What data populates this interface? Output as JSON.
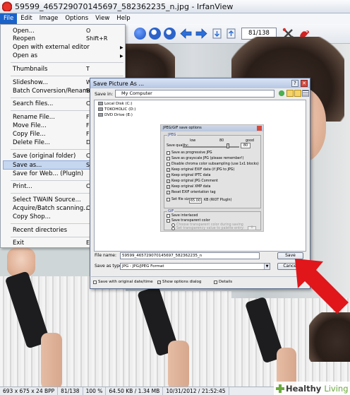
{
  "window": {
    "title": "59599_465729070145697_582362235_n.jpg - IrfanView"
  },
  "menubar": {
    "items": [
      "File",
      "Edit",
      "Image",
      "Options",
      "View",
      "Help"
    ]
  },
  "toolbar": {
    "page_counter": "81/138",
    "icons": [
      "info-icon",
      "zoom-in-icon",
      "zoom-out-icon",
      "previous-icon",
      "next-icon",
      "copy-icon",
      "paste-icon",
      "settings-icon",
      "irfanview-logo-icon"
    ]
  },
  "file_menu": {
    "items": [
      {
        "label": "Open...",
        "shortcut": "O"
      },
      {
        "label": "Reopen",
        "shortcut": "Shift+R"
      },
      {
        "label": "Open with external editor",
        "shortcut": ""
      },
      {
        "label": "Open as",
        "shortcut": ""
      },
      {
        "label": "Thumbnails",
        "shortcut": "T"
      },
      {
        "label": "Slideshow...",
        "shortcut": "W"
      },
      {
        "label": "Batch Conversion/Rename...",
        "shortcut": "B"
      },
      {
        "label": "Search files...",
        "shortcut": "C"
      },
      {
        "label": "Rename File...",
        "shortcut": "F"
      },
      {
        "label": "Move File...",
        "shortcut": "F"
      },
      {
        "label": "Copy File...",
        "shortcut": "F"
      },
      {
        "label": "Delete File...",
        "shortcut": "D"
      },
      {
        "label": "Save (original folder)",
        "shortcut": "C"
      },
      {
        "label": "Save as...",
        "shortcut": "S"
      },
      {
        "label": "Save for Web... (PlugIn)",
        "shortcut": ""
      },
      {
        "label": "Print...",
        "shortcut": "C"
      },
      {
        "label": "Select TWAIN Source...",
        "shortcut": ""
      },
      {
        "label": "Acquire/Batch scanning...",
        "shortcut": "C"
      },
      {
        "label": "Copy Shop...",
        "shortcut": ""
      },
      {
        "label": "Recent directories",
        "shortcut": ""
      },
      {
        "label": "Exit",
        "shortcut": "E"
      }
    ]
  },
  "dialog": {
    "title": "Save Picture As ...",
    "save_in_label": "Save in:",
    "save_in_value": "My Computer",
    "drives": [
      "Local Disk (C:)",
      "TOKOHOLIC (D:)",
      "DVD Drive (E:)"
    ],
    "file_name_label": "File name:",
    "file_name_value": "59599_465729070145697_582362235_n",
    "save_as_type_label": "Save as type:",
    "save_as_type_value": "JPG - JPG/JPEG Format",
    "save_button": "Save",
    "cancel_button": "Cancel",
    "bottom_checks": [
      {
        "label": "Save with original date/time",
        "checked": false
      },
      {
        "label": "Show options dialog",
        "checked": true
      },
      {
        "label": "Details",
        "checked": false
      }
    ]
  },
  "options": {
    "title": "JPEG/GIF save options",
    "jpeg_group": "JPEG",
    "quality_label": "Save quality:",
    "low": "low",
    "mid": "80",
    "good": "good",
    "quality_value": "80",
    "quality_level": 0.8,
    "jpeg_checks": [
      {
        "label": "Save as progressive JPG",
        "checked": false
      },
      {
        "label": "Save as grayscale JPG (please remember!)",
        "checked": false
      },
      {
        "label": "Disable chroma color subsampling (use 1x1 blocks)",
        "checked": false
      },
      {
        "label": "Keep original EXIF data (if JPG to JPG)",
        "checked": true
      },
      {
        "label": "Keep original IPTC data",
        "checked": true
      },
      {
        "label": "Keep original JPG Comment",
        "checked": true
      },
      {
        "label": "Keep original XMP data",
        "checked": true
      },
      {
        "label": "Reset EXIF orientation tag",
        "checked": true
      }
    ],
    "file_size_label": "Set file size:",
    "file_size_value": "65.00",
    "file_size_unit": "KB (RIOT PlugIn)",
    "gif_group": "GIF",
    "gif_checks": [
      {
        "label": "Save interlaced",
        "checked": false
      },
      {
        "label": "Save transparent color",
        "checked": false
      }
    ],
    "gif_radios": [
      {
        "label": "Choose transparent color during saving"
      },
      {
        "label": "Set transparency value to palette entry:",
        "value": "0"
      }
    ]
  },
  "statusbar": {
    "items": [
      "693 x 675 x 24 BPP",
      "81/138",
      "100 %",
      "64.50 KB / 1.34 MB",
      "10/31/2012 / 21:52:45"
    ]
  },
  "watermark": {
    "brand": "Healthy",
    "brand2": "Living"
  },
  "colors": {
    "accent": "#1a62c8",
    "arrow": "#e0161b",
    "brand_green": "#6aaa3c"
  }
}
